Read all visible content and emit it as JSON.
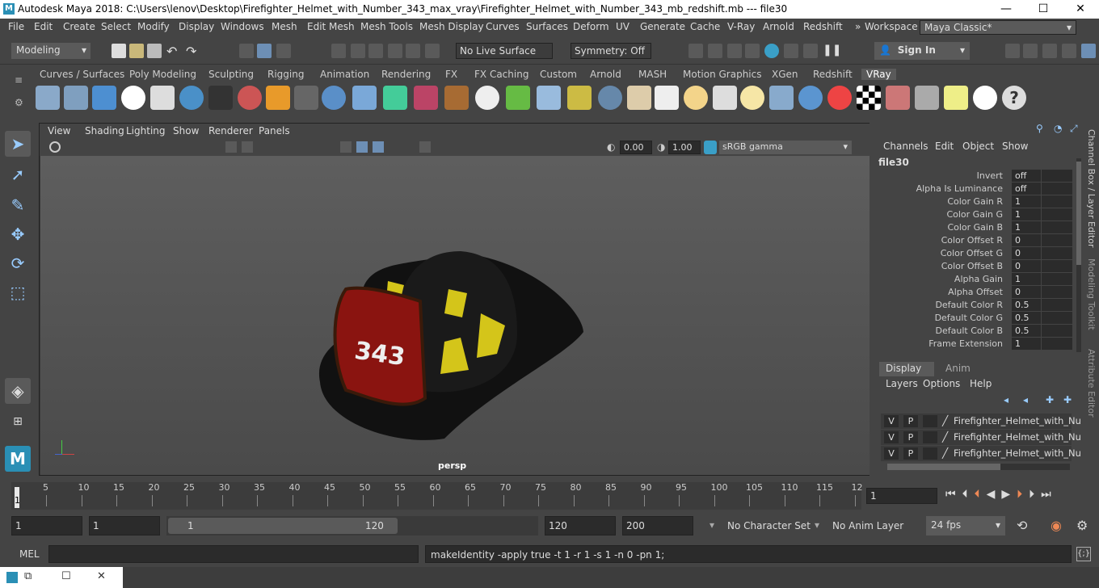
{
  "window": {
    "title": "Autodesk Maya 2018: C:\\Users\\lenov\\Desktop\\Firefighter_Helmet_with_Number_343_max_vray\\Firefighter_Helmet_with_Number_343_mb_redshift.mb  ---  file30",
    "minimize": "—",
    "maximize": "☐",
    "close": "✕"
  },
  "menus": [
    "File",
    "Edit",
    "Create",
    "Select",
    "Modify",
    "Display",
    "Windows",
    "Mesh",
    "Edit Mesh",
    "Mesh Tools",
    "Mesh Display",
    "Curves",
    "Surfaces",
    "Deform",
    "UV",
    "Generate",
    "Cache",
    "V-Ray",
    "Arnold",
    "Redshift"
  ],
  "workspace": {
    "label": "Workspace :",
    "value": "Maya Classic*"
  },
  "status": {
    "mode": "Modeling",
    "live_surface": "No Live Surface",
    "symmetry": "Symmetry: Off",
    "sign_in": "Sign In"
  },
  "shelf_tabs": [
    "Curves / Surfaces",
    "Poly Modeling",
    "Sculpting",
    "Rigging",
    "Animation",
    "Rendering",
    "FX",
    "FX Caching",
    "Custom",
    "Arnold",
    "MASH",
    "Motion Graphics",
    "XGen",
    "Redshift",
    "VRay"
  ],
  "shelf_active": "VRay",
  "viewport": {
    "menus": [
      "View",
      "Shading",
      "Lighting",
      "Show",
      "Renderer",
      "Panels"
    ],
    "exposure": "0.00",
    "gamma": "1.00",
    "color_space": "sRGB gamma",
    "camera": "persp",
    "helmet_number": "343"
  },
  "channel_box": {
    "menus": [
      "Channels",
      "Edit",
      "Object",
      "Show"
    ],
    "node": "file30",
    "attrs": [
      {
        "name": "Invert",
        "value": "off"
      },
      {
        "name": "Alpha Is Luminance",
        "value": "off"
      },
      {
        "name": "Color Gain R",
        "value": "1"
      },
      {
        "name": "Color Gain G",
        "value": "1"
      },
      {
        "name": "Color Gain B",
        "value": "1"
      },
      {
        "name": "Color Offset R",
        "value": "0"
      },
      {
        "name": "Color Offset G",
        "value": "0"
      },
      {
        "name": "Color Offset B",
        "value": "0"
      },
      {
        "name": "Alpha Gain",
        "value": "1"
      },
      {
        "name": "Alpha Offset",
        "value": "0"
      },
      {
        "name": "Default Color R",
        "value": "0.5"
      },
      {
        "name": "Default Color G",
        "value": "0.5"
      },
      {
        "name": "Default Color B",
        "value": "0.5"
      },
      {
        "name": "Frame Extension",
        "value": "1"
      }
    ]
  },
  "side_tabs": [
    "Channel Box / Layer Editor",
    "Modeling Toolkit",
    "Attribute Editor"
  ],
  "layer_editor": {
    "tabs": [
      "Display",
      "Anim"
    ],
    "menus": [
      "Layers",
      "Options",
      "Help"
    ],
    "layers": [
      {
        "v": "V",
        "p": "P",
        "name": "Firefighter_Helmet_with_Nu"
      },
      {
        "v": "V",
        "p": "P",
        "name": "Firefighter_Helmet_with_Nu"
      },
      {
        "v": "V",
        "p": "P",
        "name": "Firefighter_Helmet_with_Nu"
      }
    ]
  },
  "timeline": {
    "ticks": [
      "5",
      "10",
      "15",
      "20",
      "25",
      "30",
      "35",
      "40",
      "45",
      "50",
      "55",
      "60",
      "65",
      "70",
      "75",
      "80",
      "85",
      "90",
      "95",
      "100",
      "105",
      "110",
      "115",
      "12"
    ],
    "current_marker": "1",
    "current_frame": "1"
  },
  "range": {
    "start": "1",
    "anim_start": "1",
    "slider_start": "1",
    "slider_end": "120",
    "end": "120",
    "anim_end": "200",
    "character_set": "No Character Set",
    "anim_layer": "No Anim Layer",
    "fps": "24 fps"
  },
  "command": {
    "lang": "MEL",
    "result": "makeIdentity -apply true -t 1 -r 1 -s 1 -n 0 -pn 1;"
  }
}
